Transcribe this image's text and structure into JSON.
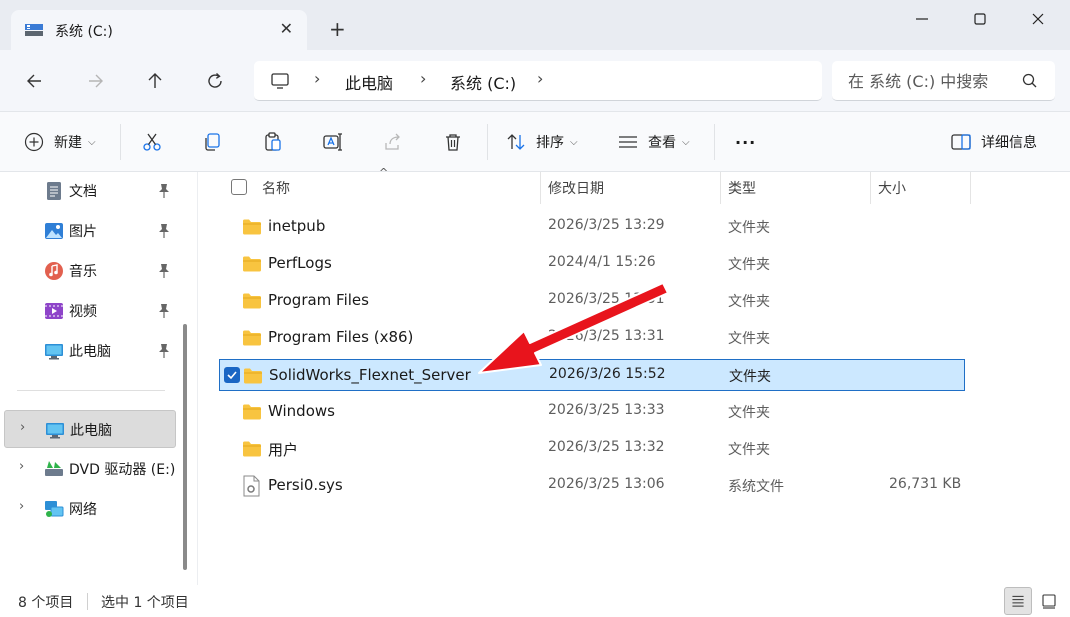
{
  "window": {
    "tab_title": "系统 (C:)",
    "close_tab": "✕",
    "new_tab": "+"
  },
  "address": {
    "crumbs": [
      "此电脑",
      "系统 (C:)"
    ],
    "separator": "›"
  },
  "search": {
    "placeholder": "在 系统 (C:) 中搜索"
  },
  "toolbar": {
    "new_label": "新建",
    "sort_label": "排序",
    "view_label": "查看",
    "more_label": "···",
    "details_label": "详细信息"
  },
  "sidebar": {
    "quick_access": [
      {
        "label": "文档",
        "icon": "document-icon"
      },
      {
        "label": "图片",
        "icon": "pictures-icon"
      },
      {
        "label": "音乐",
        "icon": "music-icon"
      },
      {
        "label": "视频",
        "icon": "video-icon"
      },
      {
        "label": "此电脑",
        "icon": "computer-icon"
      }
    ],
    "tree": [
      {
        "label": "此电脑",
        "icon": "computer-icon",
        "selected": true
      },
      {
        "label": "DVD 驱动器 (E:)",
        "icon": "dvd-drive-icon"
      },
      {
        "label": "网络",
        "icon": "network-icon"
      }
    ]
  },
  "columns": {
    "name": "名称",
    "date": "修改日期",
    "type": "类型",
    "size": "大小"
  },
  "files": [
    {
      "name": "inetpub",
      "date": "2026/3/25 13:29",
      "type": "文件夹",
      "size": ""
    },
    {
      "name": "PerfLogs",
      "date": "2024/4/1 15:26",
      "type": "文件夹",
      "size": ""
    },
    {
      "name": "Program Files",
      "date": "2026/3/25 13:31",
      "type": "文件夹",
      "size": ""
    },
    {
      "name": "Program Files (x86)",
      "date": "2026/3/25 13:31",
      "type": "文件夹",
      "size": ""
    },
    {
      "name": "SolidWorks_Flexnet_Server",
      "date": "2026/3/26 15:52",
      "type": "文件夹",
      "size": "",
      "selected": true
    },
    {
      "name": "Windows",
      "date": "2026/3/25 13:33",
      "type": "文件夹",
      "size": ""
    },
    {
      "name": "用户",
      "date": "2026/3/25 13:32",
      "type": "文件夹",
      "size": ""
    },
    {
      "name": "Persi0.sys",
      "date": "2026/3/25 13:06",
      "type": "系统文件",
      "size": "26,731 KB"
    }
  ],
  "status": {
    "item_count": "8 个项目",
    "selected_count": "选中 1 个项目"
  },
  "colors": {
    "selection_bg": "#cce8ff",
    "selection_border": "#1f6fc6",
    "folder_yellow": "#f8c440",
    "annotation_arrow": "#e8141c"
  }
}
